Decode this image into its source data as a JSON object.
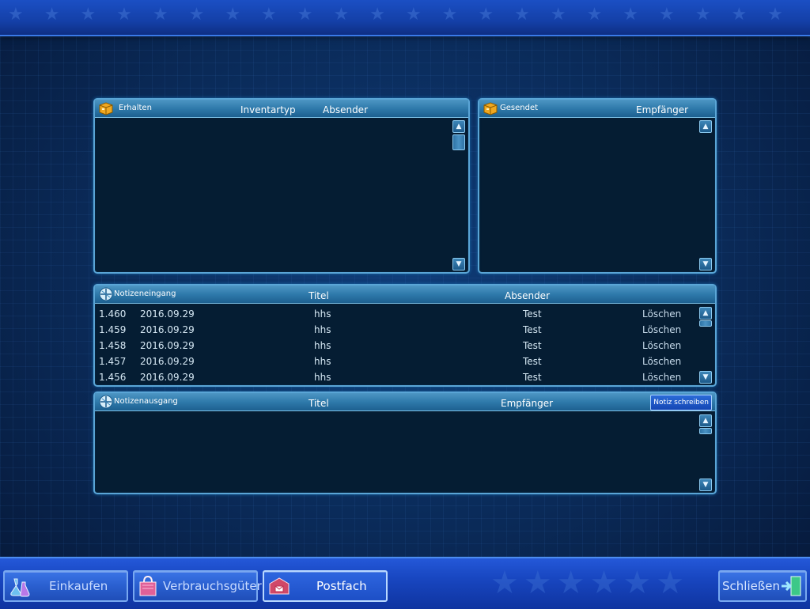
{
  "received": {
    "title": "Erhalten",
    "col_type": "Inventartyp",
    "col_sender": "Absender"
  },
  "sent": {
    "title": "Gesendet",
    "col_recipient": "Empfänger"
  },
  "inbox": {
    "title": "Notizeneingang",
    "col_title": "Titel",
    "col_sender": "Absender",
    "rows": [
      {
        "num": "1.460",
        "date": "2016.09.29",
        "title": "hhs",
        "sender": "Test",
        "delete": "Löschen"
      },
      {
        "num": "1.459",
        "date": "2016.09.29",
        "title": "hhs",
        "sender": "Test",
        "delete": "Löschen"
      },
      {
        "num": "1.458",
        "date": "2016.09.29",
        "title": "hhs",
        "sender": "Test",
        "delete": "Löschen"
      },
      {
        "num": "1.457",
        "date": "2016.09.29",
        "title": "hhs",
        "sender": "Test",
        "delete": "Löschen"
      },
      {
        "num": "1.456",
        "date": "2016.09.29",
        "title": "hhs",
        "sender": "Test",
        "delete": "Löschen"
      }
    ]
  },
  "outbox": {
    "title": "Notizenausgang",
    "col_title": "Titel",
    "col_recipient": "Empfänger",
    "write_button": "Notiz schreiben"
  },
  "nav": {
    "shop": "Einkaufen",
    "consumables": "Verbrauchsgüter",
    "mailbox": "Postfach",
    "close": "Schließen"
  },
  "icons": {
    "received": "package-icon",
    "sent": "package-icon",
    "inbox": "notes-icon",
    "outbox": "notes-icon",
    "shop": "potion-flask-icon",
    "consumables": "shopping-bag-icon",
    "mailbox": "mailbox-icon",
    "close": "exit-door-icon"
  },
  "colors": {
    "panel_bg": "#051d33",
    "panel_border": "#5aa5d6",
    "header": "#2f7aab",
    "nav_bar": "#1846c0",
    "text": "#d6e8f4"
  }
}
